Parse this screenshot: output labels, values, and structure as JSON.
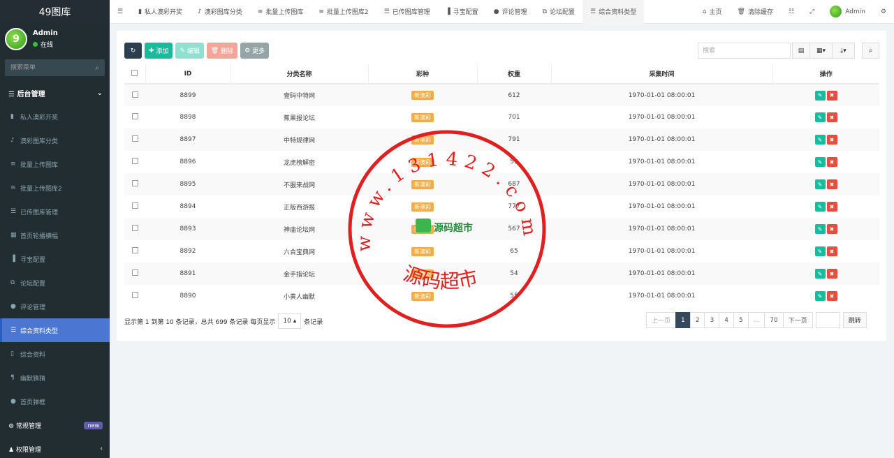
{
  "app": {
    "title": "49图库"
  },
  "user": {
    "name": "Admin",
    "status": "在线",
    "avatar_text": "9"
  },
  "sidebar": {
    "search_placeholder": "搜索菜单",
    "section": "后台管理",
    "items": [
      {
        "label": "私人澳彩开奖",
        "icon": "briefcase-icon"
      },
      {
        "label": "澳彩图库分类",
        "icon": "bell-icon"
      },
      {
        "label": "批量上传图库",
        "icon": "database-icon"
      },
      {
        "label": "批量上传图库2",
        "icon": "database-icon"
      },
      {
        "label": "已传图库管理",
        "icon": "list-icon"
      },
      {
        "label": "首页轮播横幅",
        "icon": "grid-icon"
      },
      {
        "label": "寻宝配置",
        "icon": "signal-icon"
      },
      {
        "label": "论坛配置",
        "icon": "window-icon"
      },
      {
        "label": "评论管理",
        "icon": "comments-icon"
      },
      {
        "label": "综合资料类型",
        "icon": "list-ol-icon"
      },
      {
        "label": "综合资料",
        "icon": "file-icon"
      },
      {
        "label": "幽默猜猜",
        "icon": "text-icon"
      },
      {
        "label": "首页弹框",
        "icon": "comment-icon"
      }
    ],
    "active_index": 9,
    "groups": [
      {
        "label": "常规管理",
        "badge": "new"
      },
      {
        "label": "权限管理"
      }
    ]
  },
  "topnav": {
    "tabs": [
      {
        "label": "私人澳彩开奖"
      },
      {
        "label": "澳彩图库分类"
      },
      {
        "label": "批量上传图库"
      },
      {
        "label": "批量上传图库2"
      },
      {
        "label": "已传图库管理"
      },
      {
        "label": "寻宝配置"
      },
      {
        "label": "评论管理"
      },
      {
        "label": "论坛配置"
      },
      {
        "label": "综合资料类型"
      }
    ],
    "home": "主页",
    "clear_cache": "清除缓存",
    "admin": "Admin"
  },
  "toolbar": {
    "add": "添加",
    "edit": "编辑",
    "delete": "删除",
    "more": "更多"
  },
  "search": {
    "placeholder": "搜索"
  },
  "table": {
    "headers": [
      "ID",
      "分类名称",
      "彩种",
      "权重",
      "采集时间",
      "操作"
    ],
    "rows": [
      {
        "id": "8899",
        "name": "壹码中特网",
        "type": "新澳彩",
        "weight": "612",
        "time": "1970-01-01 08:00:01"
      },
      {
        "id": "8898",
        "name": "蕉果报论坛",
        "type": "新澳彩",
        "weight": "701",
        "time": "1970-01-01 08:00:01"
      },
      {
        "id": "8897",
        "name": "中特规律网",
        "type": "新澳彩",
        "weight": "791",
        "time": "1970-01-01 08:00:01"
      },
      {
        "id": "8896",
        "name": "龙虎榜解密",
        "type": "新澳彩",
        "weight": "59",
        "time": "1970-01-01 08:00:01"
      },
      {
        "id": "8895",
        "name": "不服来战网",
        "type": "新澳彩",
        "weight": "687",
        "time": "1970-01-01 08:00:01"
      },
      {
        "id": "8894",
        "name": "正版西游报",
        "type": "新澳彩",
        "weight": "777",
        "time": "1970-01-01 08:00:01"
      },
      {
        "id": "8893",
        "name": "神庙论坛网",
        "type": "新澳彩",
        "weight": "567",
        "time": "1970-01-01 08:00:01"
      },
      {
        "id": "8892",
        "name": "六合宝典网",
        "type": "新澳彩",
        "weight": "65",
        "time": "1970-01-01 08:00:01"
      },
      {
        "id": "8891",
        "name": "金手指论坛",
        "type": "新澳彩",
        "weight": "54",
        "time": "1970-01-01 08:00:01"
      },
      {
        "id": "8890",
        "name": "小黄人幽默",
        "type": "新澳彩",
        "weight": "55",
        "time": "1970-01-01 08:00:01"
      }
    ]
  },
  "footer": {
    "info_prefix": "显示第 1 到第 10 条记录，总共 699 条记录 每页显示",
    "page_size": "10",
    "info_suffix": "条记录"
  },
  "pagination": {
    "prev": "上一页",
    "pages": [
      "1",
      "2",
      "3",
      "4",
      "5",
      "...",
      "70"
    ],
    "next": "下一页",
    "jump": "跳转"
  },
  "watermark": {
    "ring_text": "www.131422.com",
    "center_text": "源码超市",
    "bottom_text": "源码超市"
  },
  "colors": {
    "sidebar_bg": "#222d32",
    "active": "#4b76d1",
    "add": "#18bc9c",
    "stamp": "#e02020"
  }
}
